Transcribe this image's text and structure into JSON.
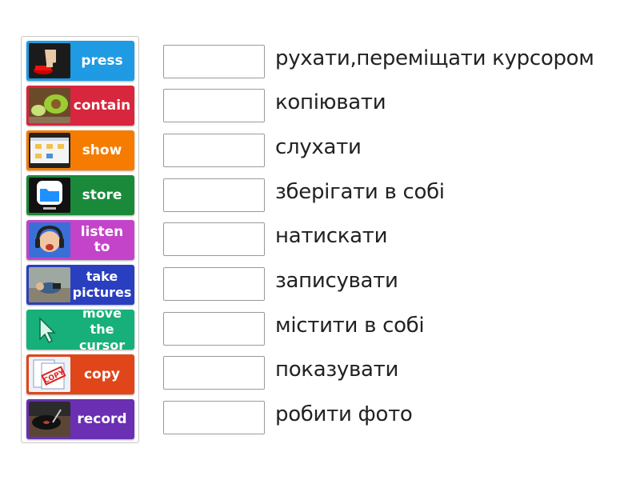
{
  "cards": [
    {
      "label": "press",
      "color": "#1e9be3",
      "icon": "red-button-icon"
    },
    {
      "label": "contain",
      "color": "#d7263d",
      "icon": "avocado-icon"
    },
    {
      "label": "show",
      "color": "#f57c00",
      "icon": "folder-window-icon"
    },
    {
      "label": "store",
      "color": "#1a8a3a",
      "icon": "files-app-icon"
    },
    {
      "label": "listen to",
      "color": "#c444c9",
      "icon": "headphones-boy-icon"
    },
    {
      "label": "take pictures",
      "color": "#2a3fbf",
      "icon": "photographer-icon"
    },
    {
      "label": "move the cursor",
      "color": "#17b07a",
      "icon": "cursor-arrow-icon"
    },
    {
      "label": "copy",
      "color": "#e0461a",
      "icon": "copy-stamp-icon"
    },
    {
      "label": "record",
      "color": "#6a2fb3",
      "icon": "turntable-icon"
    }
  ],
  "definitions": [
    "рухати,переміщати курсором",
    "копіювати",
    "слухати",
    "зберігати в собі",
    "натискати",
    "записувати",
    "містити в собі",
    "показувати",
    "робити фото"
  ]
}
